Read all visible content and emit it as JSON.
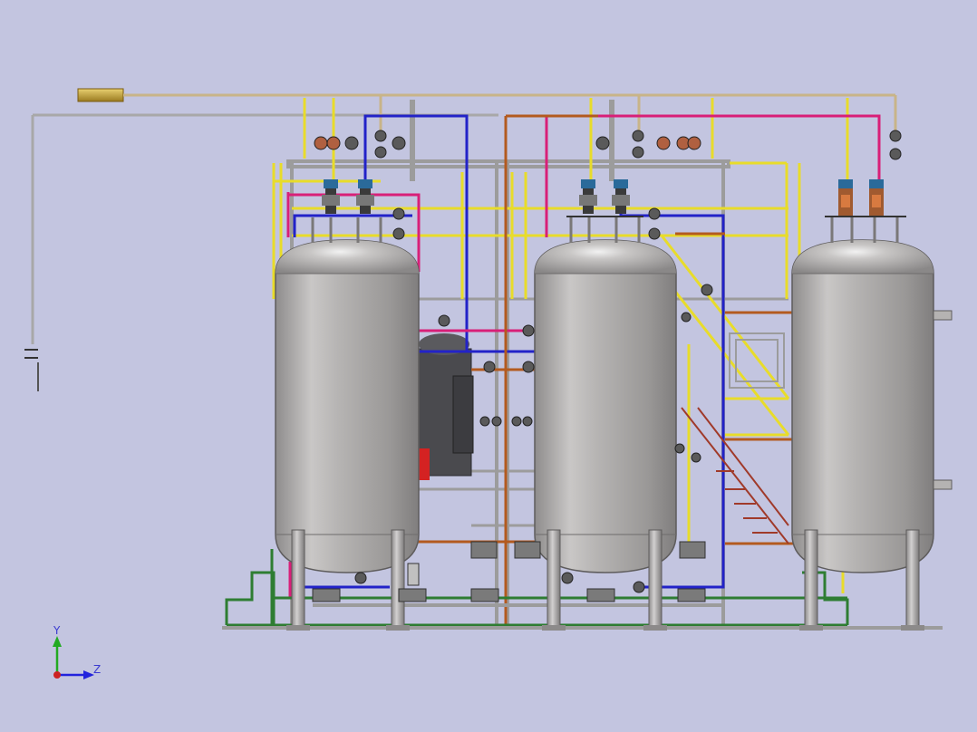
{
  "scene": {
    "background": "#c3c5e0",
    "tanks": [
      {
        "name": "tank-left"
      },
      {
        "name": "tank-middle"
      },
      {
        "name": "tank-right"
      }
    ],
    "pipe_colors": {
      "yellow": "#e8dc2a",
      "blue": "#2222c8",
      "magenta": "#d81f78",
      "brown": "#b35a1f",
      "gray": "#a8a8a8",
      "green": "#2e7d32",
      "tan": "#c8b488"
    }
  },
  "triad": {
    "y_label": "Y",
    "z_label": "Z",
    "y_color": "#22aa22",
    "z_color": "#2222dd",
    "origin_color": "#cc2222"
  }
}
